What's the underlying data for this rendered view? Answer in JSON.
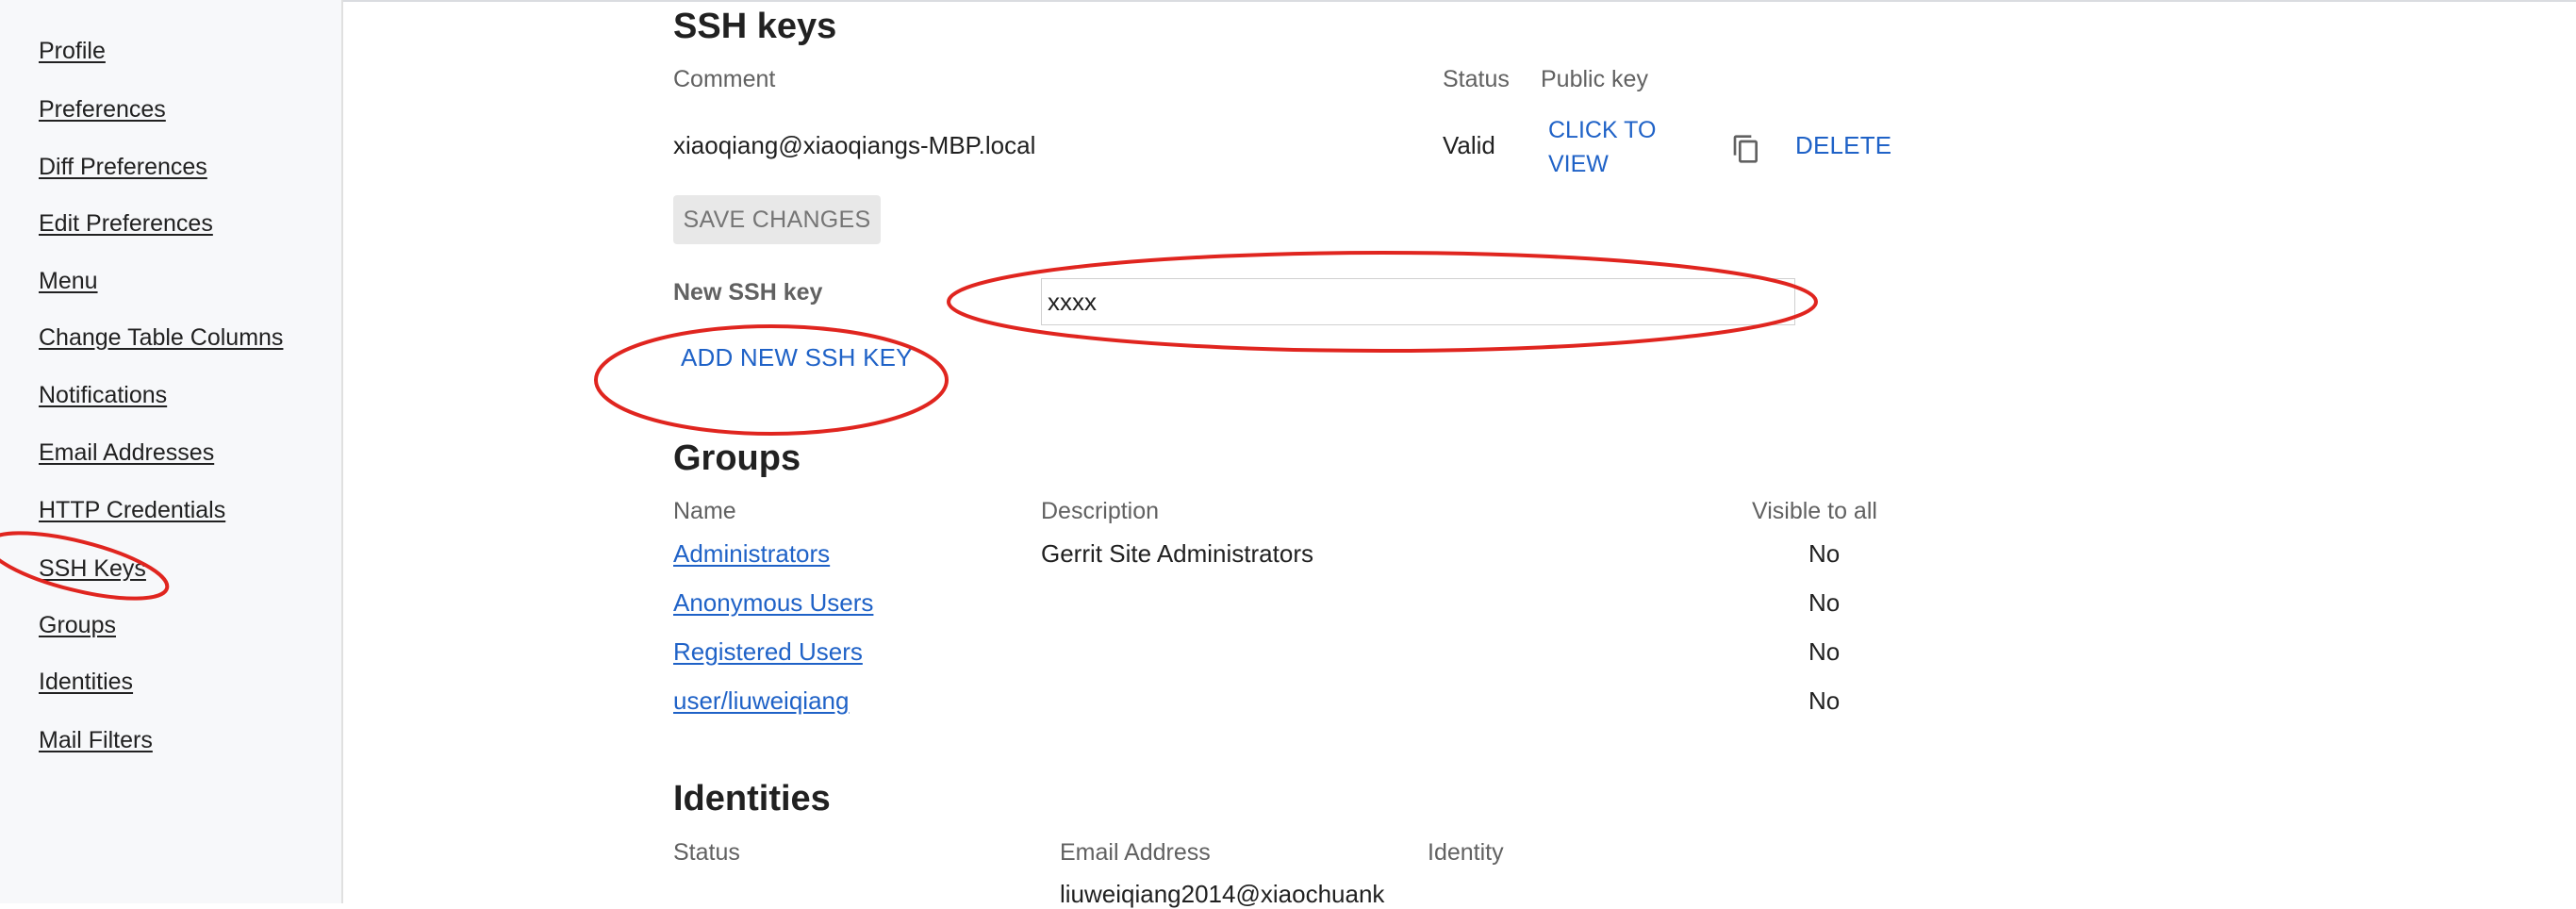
{
  "sidebar": {
    "items": [
      {
        "label": "Profile"
      },
      {
        "label": "Preferences"
      },
      {
        "label": "Diff Preferences"
      },
      {
        "label": "Edit Preferences"
      },
      {
        "label": "Menu"
      },
      {
        "label": "Change Table Columns"
      },
      {
        "label": "Notifications"
      },
      {
        "label": "Email Addresses"
      },
      {
        "label": "HTTP Credentials"
      },
      {
        "label": "SSH Keys"
      },
      {
        "label": "Groups"
      },
      {
        "label": "Identities"
      },
      {
        "label": "Mail Filters"
      }
    ]
  },
  "ssh_keys": {
    "title": "SSH keys",
    "headers": {
      "comment": "Comment",
      "status": "Status",
      "public_key": "Public key"
    },
    "rows": [
      {
        "comment": "xiaoqiang@xiaoqiangs-MBP.local",
        "status": "Valid",
        "view_label": "CLICK TO VIEW",
        "delete_label": "DELETE"
      }
    ],
    "save_label": "SAVE CHANGES",
    "new_key_label": "New SSH key",
    "new_key_value": "xxxx",
    "add_label": "ADD NEW SSH KEY",
    "icons": {
      "copy": "copy-icon"
    }
  },
  "groups": {
    "title": "Groups",
    "headers": {
      "name": "Name",
      "description": "Description",
      "visible": "Visible to all"
    },
    "rows": [
      {
        "name": "Administrators",
        "description": "Gerrit Site Administrators",
        "visible": "No"
      },
      {
        "name": "Anonymous Users",
        "description": "",
        "visible": "No"
      },
      {
        "name": "Registered Users",
        "description": "",
        "visible": "No"
      },
      {
        "name": "user/liuweiqiang",
        "description": "",
        "visible": "No"
      }
    ]
  },
  "identities": {
    "title": "Identities",
    "headers": {
      "status": "Status",
      "email": "Email Address",
      "identity": "Identity"
    },
    "rows": [
      {
        "email": "liuweiqiang2014@xiaochuank"
      }
    ]
  },
  "colors": {
    "link": "#1f62c7",
    "annotation": "#e0251f",
    "sidebar_bg": "#f7f8fa"
  }
}
